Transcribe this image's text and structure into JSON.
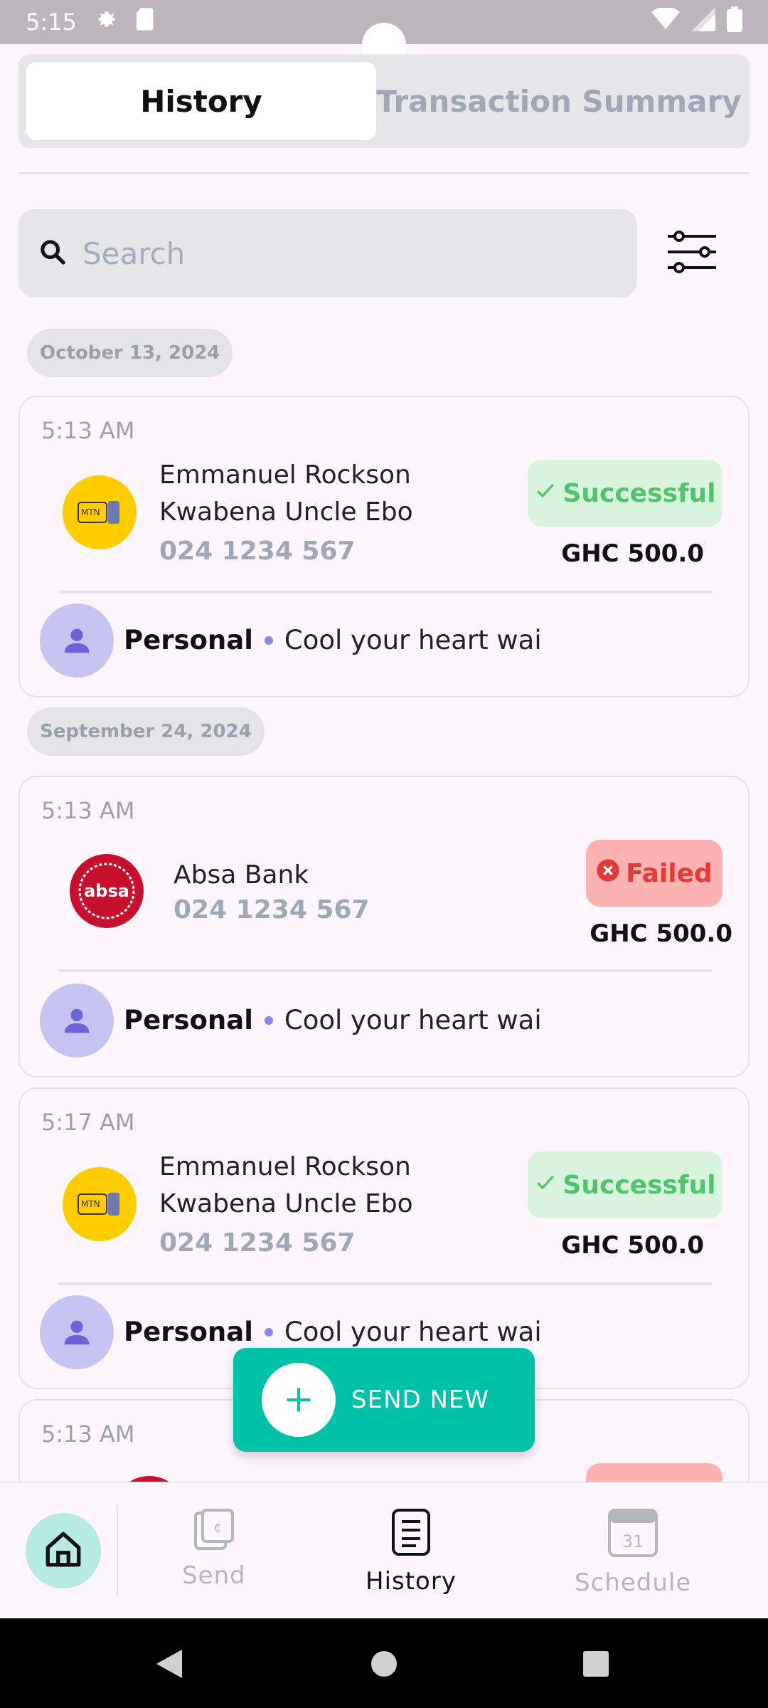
{
  "status_bar": {
    "time": "5:15"
  },
  "tabs": [
    {
      "label": "History",
      "active": true
    },
    {
      "label": "Transaction Summary",
      "active": false
    }
  ],
  "search": {
    "placeholder": "Search",
    "value": ""
  },
  "groups": [
    {
      "date": "October 13, 2024"
    },
    {
      "date": "September 24, 2024"
    }
  ],
  "transactions": [
    {
      "time": "5:13 AM",
      "provider": "MTN",
      "name_line1": "Emmanuel Rockson",
      "name_line2": "Kwabena Uncle Ebo",
      "phone": "024 1234 567",
      "status": "Successful",
      "amount": "GHC 500.0",
      "category": "Personal",
      "note": "Cool your heart wai"
    },
    {
      "time": "5:13 AM",
      "provider": "absa",
      "name_line1": "Absa Bank",
      "phone": "024 1234 567",
      "status": "Failed",
      "amount": "GHC 500.0",
      "category": "Personal",
      "note": "Cool your heart wai"
    },
    {
      "time": "5:17 AM",
      "provider": "MTN",
      "name_line1": "Emmanuel Rockson",
      "name_line2": "Kwabena Uncle Ebo",
      "phone": "024 1234 567",
      "status": "Successful",
      "amount": "GHC 500.0",
      "category": "Personal",
      "note": "Cool your heart wai"
    },
    {
      "time": "5:13 AM"
    }
  ],
  "fab": {
    "label": "SEND NEW"
  },
  "bottom_nav": [
    {
      "label": "Send",
      "active": false
    },
    {
      "label": "History",
      "active": true
    },
    {
      "label": "Schedule",
      "active": false,
      "calendar_day": "31"
    }
  ],
  "colors": {
    "accent": "#00c2a8",
    "success_bg": "#d8f4dc",
    "success_text": "#4fc46b",
    "failed_bg": "#fbb2b0",
    "failed_text": "#e43a35"
  }
}
